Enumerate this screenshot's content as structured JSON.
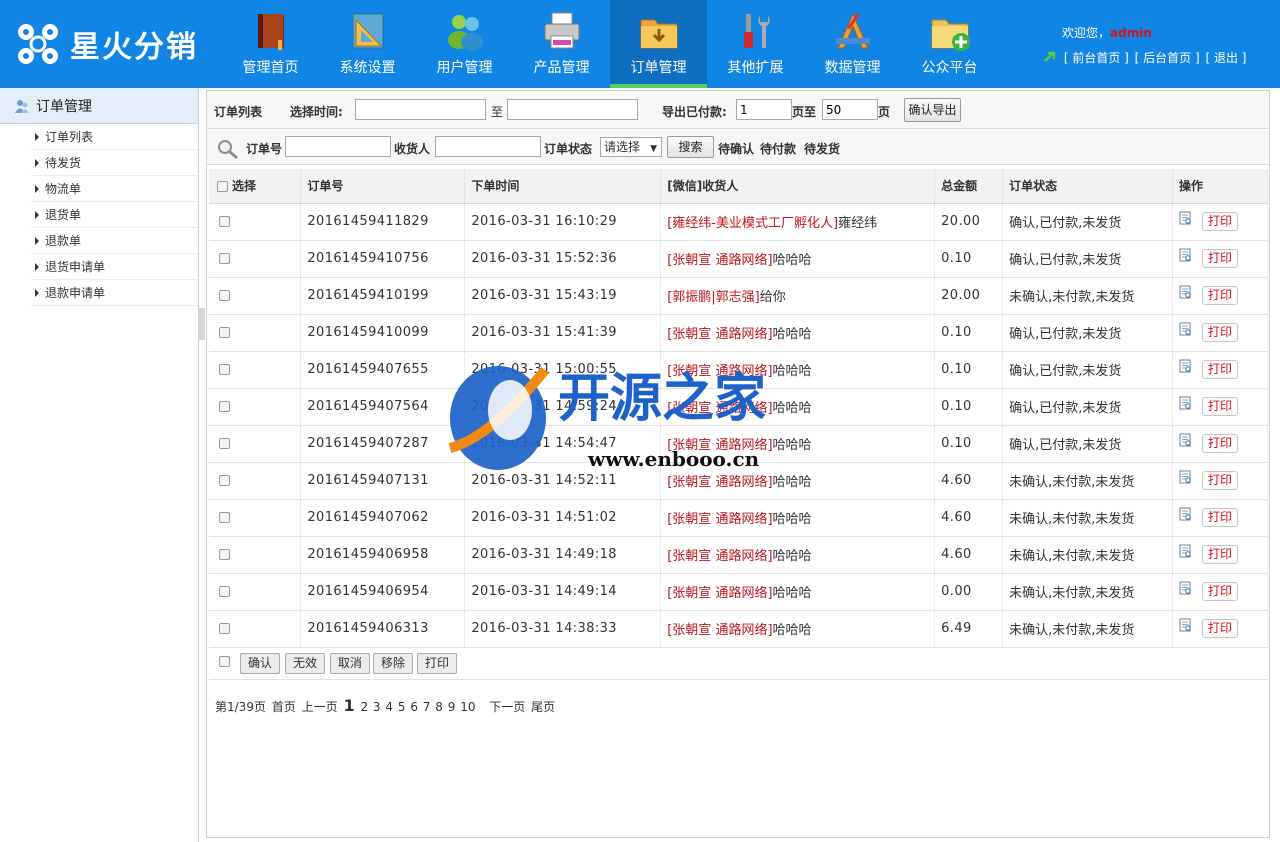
{
  "brand": {
    "name": "星火分销"
  },
  "nav": [
    {
      "label": "管理首页",
      "icon": "book-icon"
    },
    {
      "label": "系统设置",
      "icon": "ruler-icon"
    },
    {
      "label": "用户管理",
      "icon": "users-icon"
    },
    {
      "label": "产品管理",
      "icon": "printer-icon"
    },
    {
      "label": "订单管理",
      "icon": "folder-icon",
      "active": true
    },
    {
      "label": "其他扩展",
      "icon": "tools-icon"
    },
    {
      "label": "数据管理",
      "icon": "design-icon"
    },
    {
      "label": "公众平台",
      "icon": "folder-add-icon"
    }
  ],
  "header": {
    "welcome_prefix": "欢迎您，",
    "username": "admin",
    "links": [
      "[ 前台首页 ]",
      "[ 后台首页 ]",
      "[ 退出 ]"
    ]
  },
  "sidebar": {
    "title": "订单管理",
    "items": [
      "订单列表",
      "待发货",
      "物流单",
      "退货单",
      "退款单",
      "退货申请单",
      "退款申请单"
    ]
  },
  "export_bar": {
    "list_label": "订单列表",
    "time_label": "选择时间:",
    "time_from": "",
    "to_label": "至",
    "time_to": "",
    "export_label": "导出已付款:",
    "page_from": "1",
    "page_to_label": "页至",
    "page_to": "50",
    "page_suffix": "页",
    "confirm_button": "确认导出"
  },
  "search_bar": {
    "order_no_label": "订单号",
    "order_no_value": "",
    "receiver_label": "收货人",
    "receiver_value": "",
    "status_label": "订单状态",
    "status_selected": "请选择",
    "search_button": "搜索",
    "quick_filters": [
      "待确认",
      "待付款",
      "待发货"
    ]
  },
  "table": {
    "columns": [
      "选择",
      "订单号",
      "下单时间",
      "[微信]收货人",
      "总金额",
      "订单状态",
      "操作"
    ],
    "print_label": "打印",
    "rows": [
      {
        "order_no": "20161459411829",
        "time": "2016-03-31 16:10:29",
        "wechat": "[雍经纬-美业模式工厂孵化人]",
        "receiver": "雍经纬",
        "amount": "20.00",
        "status": "确认,已付款,未发货"
      },
      {
        "order_no": "20161459410756",
        "time": "2016-03-31 15:52:36",
        "wechat": "[张朝宣 通路网络]",
        "receiver": "哈哈哈",
        "amount": "0.10",
        "status": "确认,已付款,未发货"
      },
      {
        "order_no": "20161459410199",
        "time": "2016-03-31 15:43:19",
        "wechat": "[郭振鹏|郭志强]",
        "receiver": "给你",
        "amount": "20.00",
        "status": "未确认,未付款,未发货"
      },
      {
        "order_no": "20161459410099",
        "time": "2016-03-31 15:41:39",
        "wechat": "[张朝宣 通路网络]",
        "receiver": "哈哈哈",
        "amount": "0.10",
        "status": "确认,已付款,未发货"
      },
      {
        "order_no": "20161459407655",
        "time": "2016-03-31 15:00:55",
        "wechat": "[张朝宣 通路网络]",
        "receiver": "哈哈哈",
        "amount": "0.10",
        "status": "确认,已付款,未发货"
      },
      {
        "order_no": "20161459407564",
        "time": "2016-03-31 14:59:24",
        "wechat": "[张朝宣 通路网络]",
        "receiver": "哈哈哈",
        "amount": "0.10",
        "status": "确认,已付款,未发货"
      },
      {
        "order_no": "20161459407287",
        "time": "2016-03-31 14:54:47",
        "wechat": "[张朝宣 通路网络]",
        "receiver": "哈哈哈",
        "amount": "0.10",
        "status": "确认,已付款,未发货"
      },
      {
        "order_no": "20161459407131",
        "time": "2016-03-31 14:52:11",
        "wechat": "[张朝宣 通路网络]",
        "receiver": "哈哈哈",
        "amount": "4.60",
        "status": "未确认,未付款,未发货"
      },
      {
        "order_no": "20161459407062",
        "time": "2016-03-31 14:51:02",
        "wechat": "[张朝宣 通路网络]",
        "receiver": "哈哈哈",
        "amount": "4.60",
        "status": "未确认,未付款,未发货"
      },
      {
        "order_no": "20161459406958",
        "time": "2016-03-31 14:49:18",
        "wechat": "[张朝宣 通路网络]",
        "receiver": "哈哈哈",
        "amount": "4.60",
        "status": "未确认,未付款,未发货"
      },
      {
        "order_no": "20161459406954",
        "time": "2016-03-31 14:49:14",
        "wechat": "[张朝宣 通路网络]",
        "receiver": "哈哈哈",
        "amount": "0.00",
        "status": "未确认,未付款,未发货"
      },
      {
        "order_no": "20161459406313",
        "time": "2016-03-31 14:38:33",
        "wechat": "[张朝宣 通路网络]",
        "receiver": "哈哈哈",
        "amount": "6.49",
        "status": "未确认,未付款,未发货"
      }
    ]
  },
  "bulk_actions": [
    "确认",
    "无效",
    "取消",
    "移除",
    "打印"
  ],
  "pager": {
    "info": "第1/39页",
    "first": "首页",
    "prev": "上一页",
    "current": "1",
    "pages": [
      "2",
      "3",
      "4",
      "5",
      "6",
      "7",
      "8",
      "9",
      "10"
    ],
    "next": "下一页",
    "last": "尾页"
  },
  "watermark": {
    "title": "开源之家",
    "url": "www.enbooo.cn"
  },
  "colors": {
    "header_bg": "#1185e3",
    "active_nav": "#0e6fc1",
    "active_underline": "#51d25b",
    "accent_red": "#d3121a"
  }
}
